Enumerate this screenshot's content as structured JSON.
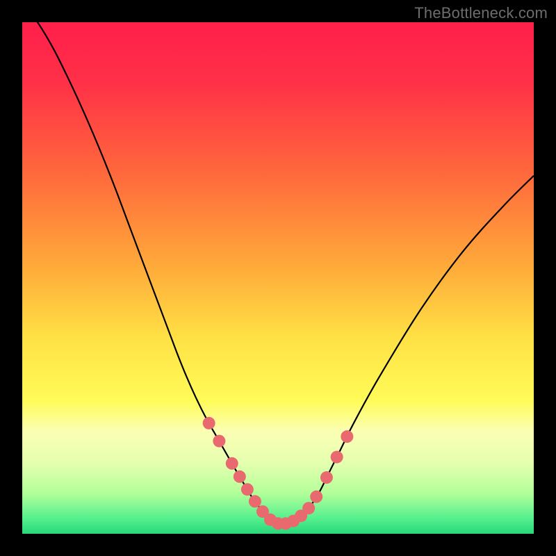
{
  "watermark": "TheBottleneck.com",
  "gradient_stops": [
    {
      "pct": 0,
      "color": "#ff1f4b"
    },
    {
      "pct": 12,
      "color": "#ff3147"
    },
    {
      "pct": 30,
      "color": "#ff6a3c"
    },
    {
      "pct": 48,
      "color": "#ffab3a"
    },
    {
      "pct": 62,
      "color": "#ffe245"
    },
    {
      "pct": 74,
      "color": "#fffb58"
    },
    {
      "pct": 80,
      "color": "#fbffb4"
    },
    {
      "pct": 86,
      "color": "#e6ffb0"
    },
    {
      "pct": 92,
      "color": "#b4ff9a"
    },
    {
      "pct": 97,
      "color": "#55f08e"
    },
    {
      "pct": 100,
      "color": "#28d77a"
    }
  ],
  "marker_color": "#e86a6f",
  "marker_radius": 9,
  "chart_data": {
    "type": "line",
    "title": "",
    "xlabel": "",
    "ylabel": "",
    "xlim": [
      0,
      100
    ],
    "ylim": [
      0,
      100
    ],
    "grid": false,
    "series": [
      {
        "name": "bottleneck-curve",
        "x": [
          0,
          3,
          6,
          9,
          12,
          15,
          18,
          21,
          24,
          27,
          30,
          32,
          34,
          36,
          38,
          40,
          42,
          43.5,
          45,
          46.5,
          48,
          50,
          52,
          54,
          56,
          58,
          60,
          62,
          65,
          70,
          78,
          86,
          94,
          100
        ],
        "y": [
          104,
          100,
          95,
          89,
          82.5,
          75.5,
          68,
          60,
          52,
          44,
          36,
          31,
          26.5,
          22.5,
          19,
          15.5,
          12,
          9.5,
          7,
          5,
          3,
          2,
          2,
          3,
          5,
          8,
          12,
          16,
          22,
          31,
          44,
          55,
          64,
          70
        ]
      }
    ],
    "markers_x": [
      36.5,
      38.5,
      41,
      42.5,
      44,
      45.5,
      47,
      48.5,
      50,
      51.5,
      53,
      54.5,
      56,
      57.5,
      59.5,
      61.5,
      63.5
    ]
  }
}
